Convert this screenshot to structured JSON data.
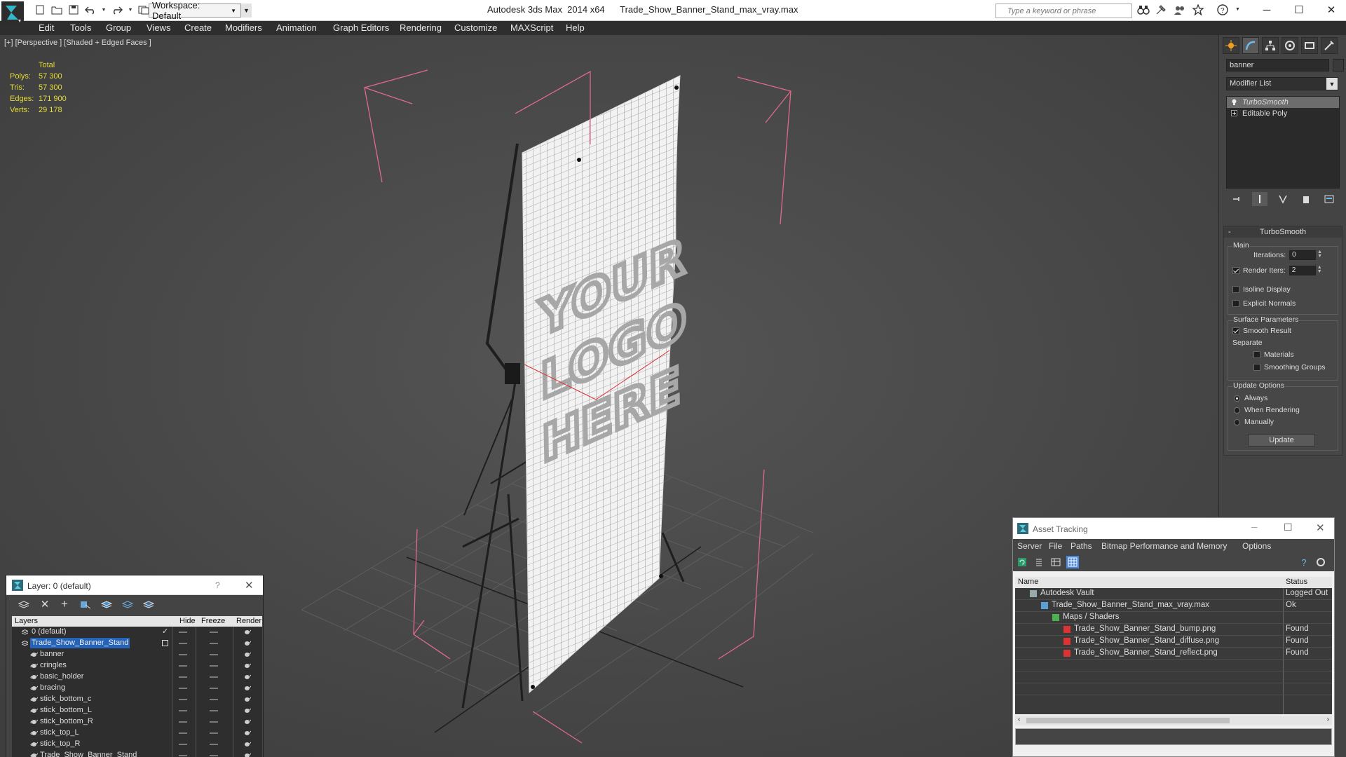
{
  "titlebar": {
    "workspace": "Workspace: Default",
    "app_name": "Autodesk 3ds Max  2014 x64",
    "file_name": "Trade_Show_Banner_Stand_max_vray.max",
    "search_placeholder": "Type a keyword or phrase"
  },
  "menu": [
    "Edit",
    "Tools",
    "Group",
    "Views",
    "Create",
    "Modifiers",
    "Animation",
    "Graph Editors",
    "Rendering",
    "Customize",
    "MAXScript",
    "Help"
  ],
  "viewport": {
    "label": "[+] [Perspective ] [Shaded + Edged Faces ]",
    "stats": {
      "header": "Total",
      "rows": [
        {
          "label": "Polys:",
          "value": "57 300"
        },
        {
          "label": "Tris:",
          "value": "57 300"
        },
        {
          "label": "Edges:",
          "value": "171 900"
        },
        {
          "label": "Verts:",
          "value": "29 178"
        }
      ]
    },
    "banner_text": [
      "YOUR",
      "LOGO",
      "HERE"
    ]
  },
  "command_panel": {
    "object_name": "banner",
    "modifier_list": "Modifier List",
    "stack": [
      "TurboSmooth",
      "Editable Poly"
    ],
    "turbosmooth": {
      "title": "TurboSmooth",
      "main_label": "Main",
      "iterations_label": "Iterations:",
      "iterations_value": "0",
      "render_iters_label": "Render Iters:",
      "render_iters_value": "2",
      "render_iters_checked": true,
      "isoline_label": "Isoline Display",
      "explicit_normals_label": "Explicit Normals",
      "surface_label": "Surface Parameters",
      "smooth_result_label": "Smooth Result",
      "separate_label": "Separate",
      "materials_label": "Materials",
      "smoothing_groups_label": "Smoothing Groups",
      "update_options_label": "Update Options",
      "always_label": "Always",
      "when_rendering_label": "When Rendering",
      "manually_label": "Manually",
      "update_button": "Update"
    }
  },
  "layer_explorer": {
    "title": "Layer: 0 (default)",
    "help": "?",
    "columns": {
      "layers": "Layers",
      "hide": "Hide",
      "freeze": "Freeze",
      "render": "Render"
    },
    "layers": [
      {
        "name": "0 (default)",
        "level": 0
      },
      {
        "name": "Trade_Show_Banner_Stand",
        "level": 0,
        "selected": true
      },
      {
        "name": "banner",
        "level": 1
      },
      {
        "name": "cringles",
        "level": 1
      },
      {
        "name": "basic_holder",
        "level": 1
      },
      {
        "name": "bracing",
        "level": 1
      },
      {
        "name": "stick_bottom_c",
        "level": 1
      },
      {
        "name": "stick_bottom_L",
        "level": 1
      },
      {
        "name": "stick_bottom_R",
        "level": 1
      },
      {
        "name": "stick_top_L",
        "level": 1
      },
      {
        "name": "stick_top_R",
        "level": 1
      },
      {
        "name": "Trade_Show_Banner_Stand",
        "level": 1
      }
    ]
  },
  "asset_tracking": {
    "title": "Asset Tracking",
    "menu": [
      "Server",
      "File",
      "Paths",
      "Bitmap Performance and Memory",
      "Options"
    ],
    "columns": {
      "name": "Name",
      "status": "Status"
    },
    "rows": [
      {
        "name": "Autodesk Vault",
        "status": "Logged Out",
        "level": 0,
        "icon": "vault-icon"
      },
      {
        "name": "Trade_Show_Banner_Stand_max_vray.max",
        "status": "Ok",
        "level": 1,
        "icon": "max-file-icon"
      },
      {
        "name": "Maps / Shaders",
        "status": "",
        "level": 2,
        "icon": "maps-icon"
      },
      {
        "name": "Trade_Show_Banner_Stand_bump.png",
        "status": "Found",
        "level": 3,
        "icon": "png-icon"
      },
      {
        "name": "Trade_Show_Banner_Stand_diffuse.png",
        "status": "Found",
        "level": 3,
        "icon": "png-icon"
      },
      {
        "name": "Trade_Show_Banner_Stand_reflect.png",
        "status": "Found",
        "level": 3,
        "icon": "png-icon"
      }
    ]
  },
  "colors": {
    "selection_bracket": "#e06a8a",
    "stats_text": "#e6dc3a",
    "layer_selection": "#2463b8"
  }
}
